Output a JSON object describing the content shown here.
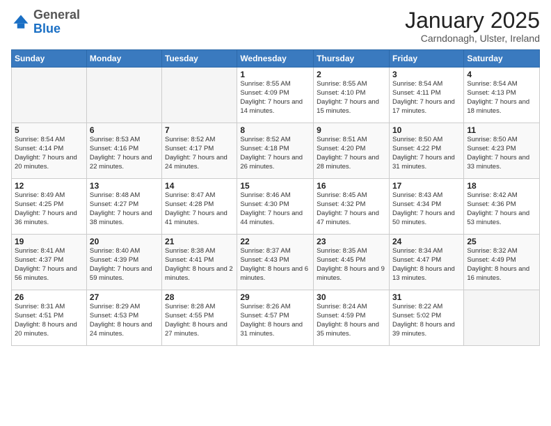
{
  "header": {
    "logo_general": "General",
    "logo_blue": "Blue",
    "month_title": "January 2025",
    "location": "Carndonagh, Ulster, Ireland"
  },
  "days_of_week": [
    "Sunday",
    "Monday",
    "Tuesday",
    "Wednesday",
    "Thursday",
    "Friday",
    "Saturday"
  ],
  "weeks": [
    [
      {
        "day": "",
        "sunrise": "",
        "sunset": "",
        "daylight": ""
      },
      {
        "day": "",
        "sunrise": "",
        "sunset": "",
        "daylight": ""
      },
      {
        "day": "",
        "sunrise": "",
        "sunset": "",
        "daylight": ""
      },
      {
        "day": "1",
        "sunrise": "Sunrise: 8:55 AM",
        "sunset": "Sunset: 4:09 PM",
        "daylight": "Daylight: 7 hours and 14 minutes."
      },
      {
        "day": "2",
        "sunrise": "Sunrise: 8:55 AM",
        "sunset": "Sunset: 4:10 PM",
        "daylight": "Daylight: 7 hours and 15 minutes."
      },
      {
        "day": "3",
        "sunrise": "Sunrise: 8:54 AM",
        "sunset": "Sunset: 4:11 PM",
        "daylight": "Daylight: 7 hours and 17 minutes."
      },
      {
        "day": "4",
        "sunrise": "Sunrise: 8:54 AM",
        "sunset": "Sunset: 4:13 PM",
        "daylight": "Daylight: 7 hours and 18 minutes."
      }
    ],
    [
      {
        "day": "5",
        "sunrise": "Sunrise: 8:54 AM",
        "sunset": "Sunset: 4:14 PM",
        "daylight": "Daylight: 7 hours and 20 minutes."
      },
      {
        "day": "6",
        "sunrise": "Sunrise: 8:53 AM",
        "sunset": "Sunset: 4:16 PM",
        "daylight": "Daylight: 7 hours and 22 minutes."
      },
      {
        "day": "7",
        "sunrise": "Sunrise: 8:52 AM",
        "sunset": "Sunset: 4:17 PM",
        "daylight": "Daylight: 7 hours and 24 minutes."
      },
      {
        "day": "8",
        "sunrise": "Sunrise: 8:52 AM",
        "sunset": "Sunset: 4:18 PM",
        "daylight": "Daylight: 7 hours and 26 minutes."
      },
      {
        "day": "9",
        "sunrise": "Sunrise: 8:51 AM",
        "sunset": "Sunset: 4:20 PM",
        "daylight": "Daylight: 7 hours and 28 minutes."
      },
      {
        "day": "10",
        "sunrise": "Sunrise: 8:50 AM",
        "sunset": "Sunset: 4:22 PM",
        "daylight": "Daylight: 7 hours and 31 minutes."
      },
      {
        "day": "11",
        "sunrise": "Sunrise: 8:50 AM",
        "sunset": "Sunset: 4:23 PM",
        "daylight": "Daylight: 7 hours and 33 minutes."
      }
    ],
    [
      {
        "day": "12",
        "sunrise": "Sunrise: 8:49 AM",
        "sunset": "Sunset: 4:25 PM",
        "daylight": "Daylight: 7 hours and 36 minutes."
      },
      {
        "day": "13",
        "sunrise": "Sunrise: 8:48 AM",
        "sunset": "Sunset: 4:27 PM",
        "daylight": "Daylight: 7 hours and 38 minutes."
      },
      {
        "day": "14",
        "sunrise": "Sunrise: 8:47 AM",
        "sunset": "Sunset: 4:28 PM",
        "daylight": "Daylight: 7 hours and 41 minutes."
      },
      {
        "day": "15",
        "sunrise": "Sunrise: 8:46 AM",
        "sunset": "Sunset: 4:30 PM",
        "daylight": "Daylight: 7 hours and 44 minutes."
      },
      {
        "day": "16",
        "sunrise": "Sunrise: 8:45 AM",
        "sunset": "Sunset: 4:32 PM",
        "daylight": "Daylight: 7 hours and 47 minutes."
      },
      {
        "day": "17",
        "sunrise": "Sunrise: 8:43 AM",
        "sunset": "Sunset: 4:34 PM",
        "daylight": "Daylight: 7 hours and 50 minutes."
      },
      {
        "day": "18",
        "sunrise": "Sunrise: 8:42 AM",
        "sunset": "Sunset: 4:36 PM",
        "daylight": "Daylight: 7 hours and 53 minutes."
      }
    ],
    [
      {
        "day": "19",
        "sunrise": "Sunrise: 8:41 AM",
        "sunset": "Sunset: 4:37 PM",
        "daylight": "Daylight: 7 hours and 56 minutes."
      },
      {
        "day": "20",
        "sunrise": "Sunrise: 8:40 AM",
        "sunset": "Sunset: 4:39 PM",
        "daylight": "Daylight: 7 hours and 59 minutes."
      },
      {
        "day": "21",
        "sunrise": "Sunrise: 8:38 AM",
        "sunset": "Sunset: 4:41 PM",
        "daylight": "Daylight: 8 hours and 2 minutes."
      },
      {
        "day": "22",
        "sunrise": "Sunrise: 8:37 AM",
        "sunset": "Sunset: 4:43 PM",
        "daylight": "Daylight: 8 hours and 6 minutes."
      },
      {
        "day": "23",
        "sunrise": "Sunrise: 8:35 AM",
        "sunset": "Sunset: 4:45 PM",
        "daylight": "Daylight: 8 hours and 9 minutes."
      },
      {
        "day": "24",
        "sunrise": "Sunrise: 8:34 AM",
        "sunset": "Sunset: 4:47 PM",
        "daylight": "Daylight: 8 hours and 13 minutes."
      },
      {
        "day": "25",
        "sunrise": "Sunrise: 8:32 AM",
        "sunset": "Sunset: 4:49 PM",
        "daylight": "Daylight: 8 hours and 16 minutes."
      }
    ],
    [
      {
        "day": "26",
        "sunrise": "Sunrise: 8:31 AM",
        "sunset": "Sunset: 4:51 PM",
        "daylight": "Daylight: 8 hours and 20 minutes."
      },
      {
        "day": "27",
        "sunrise": "Sunrise: 8:29 AM",
        "sunset": "Sunset: 4:53 PM",
        "daylight": "Daylight: 8 hours and 24 minutes."
      },
      {
        "day": "28",
        "sunrise": "Sunrise: 8:28 AM",
        "sunset": "Sunset: 4:55 PM",
        "daylight": "Daylight: 8 hours and 27 minutes."
      },
      {
        "day": "29",
        "sunrise": "Sunrise: 8:26 AM",
        "sunset": "Sunset: 4:57 PM",
        "daylight": "Daylight: 8 hours and 31 minutes."
      },
      {
        "day": "30",
        "sunrise": "Sunrise: 8:24 AM",
        "sunset": "Sunset: 4:59 PM",
        "daylight": "Daylight: 8 hours and 35 minutes."
      },
      {
        "day": "31",
        "sunrise": "Sunrise: 8:22 AM",
        "sunset": "Sunset: 5:02 PM",
        "daylight": "Daylight: 8 hours and 39 minutes."
      },
      {
        "day": "",
        "sunrise": "",
        "sunset": "",
        "daylight": ""
      }
    ]
  ]
}
